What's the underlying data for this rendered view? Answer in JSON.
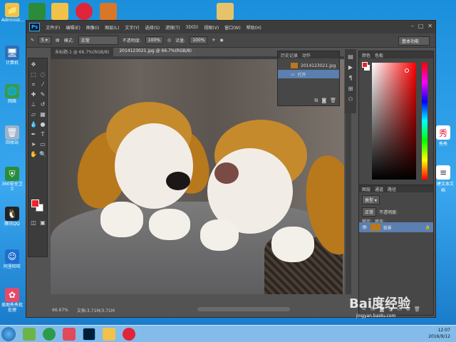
{
  "desktop": {
    "left_icons": [
      {
        "label": "Administ...",
        "icon": "user-folder-icon"
      },
      {
        "label": "计算机",
        "icon": "computer-icon"
      },
      {
        "label": "网络",
        "icon": "network-globe-icon"
      },
      {
        "label": "回收站",
        "icon": "recycle-bin-icon"
      },
      {
        "label": "360安全卫士",
        "icon": "360-shield-icon"
      },
      {
        "label": "腾讯QQ",
        "icon": "qq-penguin-icon"
      },
      {
        "label": "阿里旺旺",
        "icon": "wangwang-icon"
      },
      {
        "label": "美图秀秀批处理",
        "icon": "meitu-icon"
      }
    ],
    "right_icons": [
      {
        "label": "秀秀",
        "icon": "xiuxiu-icon"
      },
      {
        "label": "新建文本文档",
        "icon": "text-document-icon"
      }
    ]
  },
  "photoshop": {
    "logo": "Ps",
    "menu": [
      "文件(F)",
      "编辑(E)",
      "图像(I)",
      "图层(L)",
      "文字(Y)",
      "选择(S)",
      "滤镜(T)",
      "3D(D)",
      "视图(V)",
      "窗口(W)",
      "帮助(H)"
    ],
    "options": {
      "mode_label": "模式:",
      "mode_value": "正常",
      "opacity_label": "不透明度:",
      "opacity_value": "100%",
      "flow_label": "流量:",
      "flow_value": "100%"
    },
    "workspace": "基本功能",
    "tabs": [
      "未标题-1 @ 66.7%(RGB/8)",
      "2014123021.jpg @ 66.7%(RGB/8)"
    ],
    "status": {
      "zoom": "66.67%",
      "doc": "文档:3.71M/3.71M"
    },
    "history_panel": {
      "tabs": [
        "历史记录",
        "动作"
      ],
      "snapshot": "2014123021.jpg",
      "step": "打开"
    },
    "color_panel": {
      "tabs": [
        "颜色",
        "色板"
      ]
    },
    "layers_panel": {
      "tabs": [
        "图层",
        "通道",
        "路径"
      ],
      "blend_mode": "正常",
      "opacity_label": "不透明度:",
      "fill_label": "填充:",
      "layer_name": "背景"
    }
  },
  "taskbar": {
    "time": "12:07",
    "date": "2016/9/12"
  },
  "watermark": {
    "text": "Bai度经验",
    "url": "jingyan.baidu.com"
  },
  "colors": {
    "foreground": "#e8242c",
    "background": "#ffffff",
    "selection": "#5a7fb0"
  }
}
